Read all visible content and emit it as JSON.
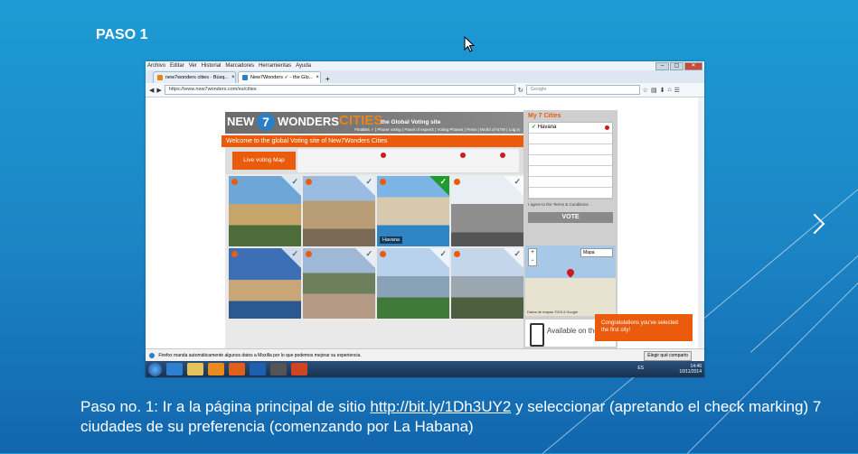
{
  "slide": {
    "title": "PASO 1",
    "caption_before": "Paso no. 1: Ir a la página principal de sitio ",
    "caption_link": "http://bit.ly/1Dh3UY2",
    "caption_after": " y seleccionar (apretando el check marking) 7 ciudades de su preferencia (comenzando por La Habana)"
  },
  "browser": {
    "menu": [
      "Archivo",
      "Editar",
      "Ver",
      "Historial",
      "Marcadores",
      "Herramientas",
      "Ayuda"
    ],
    "tabs": [
      {
        "label": "new7wonders cities - Búsq..."
      },
      {
        "label": "New7Wonders ✓ - the Glo..."
      }
    ],
    "url": "https://www.new7wonders.com/es/cities",
    "search_placeholder": "Google"
  },
  "site": {
    "logo_part1": "NEW",
    "logo_seven": "7",
    "logo_part2": "WONDERS",
    "logo_part3": "CITIES",
    "tagline": "the Global Voting site",
    "nav": "Finalists ✓ | Phone voting | Panel of experts | Voting Phases | Press | World of N7W | Log in",
    "welcome": "Welcome to the global Voting site of New7Wonders Cities",
    "live_map": "Live voting Map",
    "grid_selected_label": "Havana"
  },
  "sidebar": {
    "title": "My 7 Cities",
    "cities": [
      "Havana",
      "",
      "",
      "",
      "",
      "",
      ""
    ],
    "agree": "I agree to the Terms & Conditions",
    "vote": "VOTE",
    "map_type": "Mapa",
    "zoom": "+ −",
    "map_credit": "Datos de mapas ©2014 Google",
    "app_text": "Available on the"
  },
  "toast": "Congratulations you've selected the first city!",
  "notification": {
    "text": "Firefox manda automáticamente algunos datos a Mozilla por lo que podemos mejorar su experiencia.",
    "button": "Elegir qué comparto"
  },
  "taskbar": {
    "lang": "ES",
    "time": "14:46",
    "date": "10/11/2014"
  },
  "colors": {
    "accent": "#ea5b0c",
    "check_on": "#1f9a2c"
  }
}
